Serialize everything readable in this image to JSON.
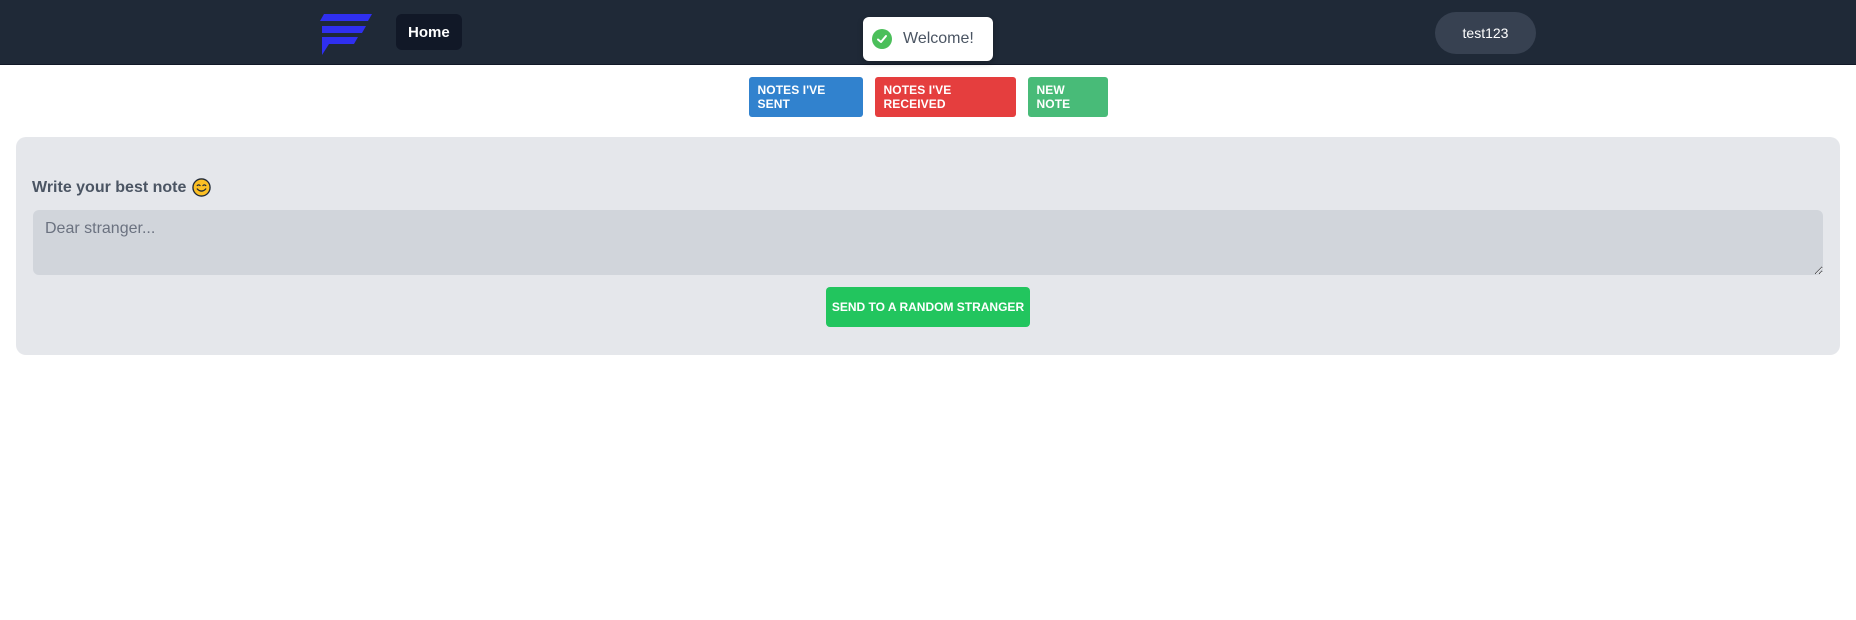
{
  "navbar": {
    "logo_icon": "brand-logo-icon",
    "home_label": "Home",
    "user_label": "test123",
    "background": "#1f2937"
  },
  "toast": {
    "message": "Welcome!",
    "icon": "check-circle-icon",
    "color": "#4bbf5a"
  },
  "tabs": [
    {
      "label": "NOTES I'VE SENT",
      "color": "#3182ce"
    },
    {
      "label": "NOTES I'VE RECEIVED",
      "color": "#e53e3e"
    },
    {
      "label": "NEW NOTE",
      "color": "#48bb78"
    }
  ],
  "note_form": {
    "label": "Write your best note",
    "label_icon": "smile-icon",
    "placeholder": "Dear stranger...",
    "value": "",
    "send_label": "SEND TO A RANDOM STRANGER",
    "send_color": "#22c55e"
  }
}
